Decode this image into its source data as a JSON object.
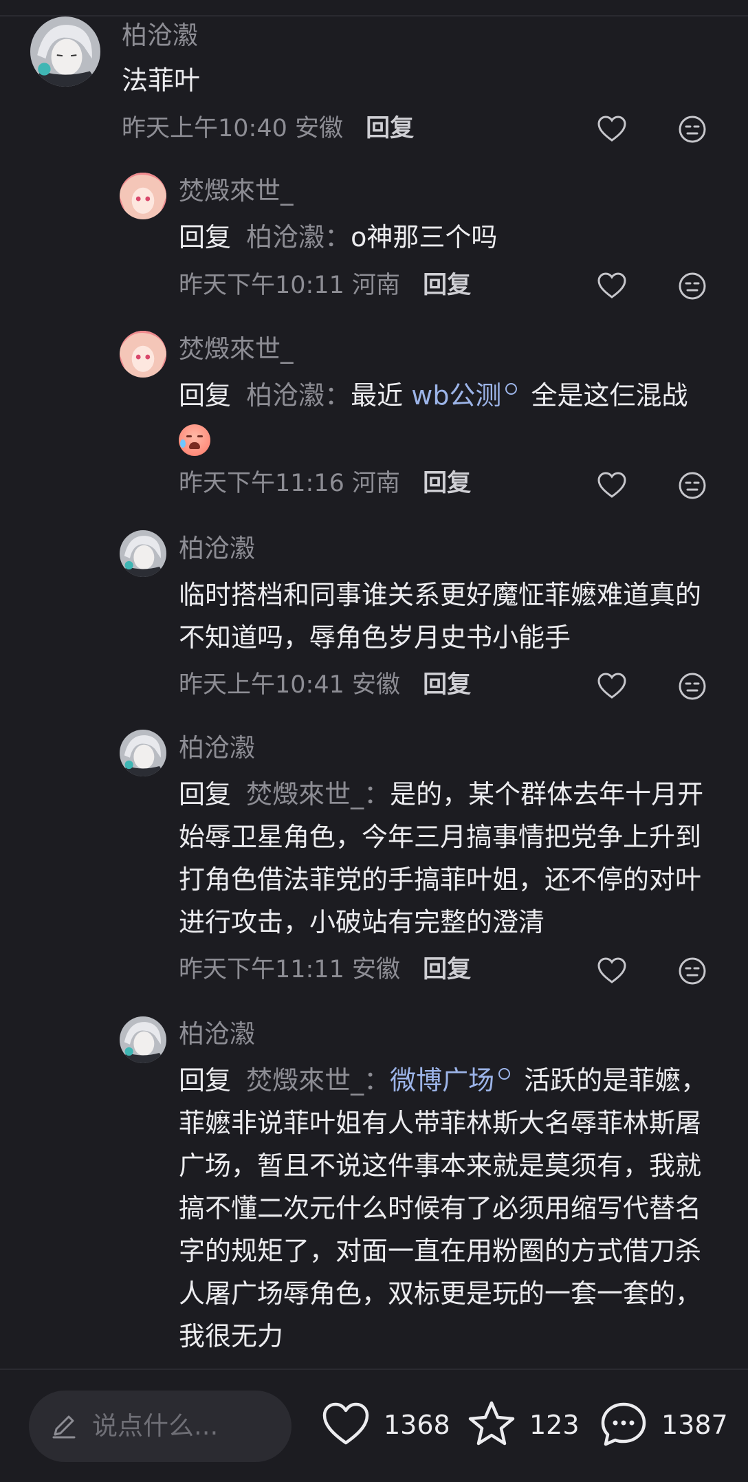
{
  "colors": {
    "background": "#1c1c21",
    "username": "#8d8d94",
    "text": "#ececef",
    "link": "#9cb4e8",
    "input_bg": "#2b2b31"
  },
  "comments": [
    {
      "username": "柏沧瀫",
      "body": "法菲叶",
      "time": "昨天上午10:40",
      "location": "安徽",
      "reply_label": "回复"
    },
    {
      "username": "焚燬來世_",
      "reply_prefix": "回复",
      "mention": "柏沧瀫",
      "sep": "：",
      "body": "o神那三个吗",
      "time": "昨天下午10:11",
      "location": "河南",
      "reply_label": "回复"
    },
    {
      "username": "焚燬來世_",
      "reply_prefix": "回复",
      "mention": "柏沧瀫",
      "sep": "：",
      "body_before": "最近 ",
      "link": "wb公测",
      "body_after": " 全是这仨混战",
      "emoji": "crying-laughing-emoji",
      "time": "昨天下午11:16",
      "location": "河南",
      "reply_label": "回复"
    },
    {
      "username": "柏沧瀫",
      "body": "临时搭档和同事谁关系更好魔怔菲嬷难道真的不知道吗，辱角色岁月史书小能手",
      "time": "昨天上午10:41",
      "location": "安徽",
      "reply_label": "回复"
    },
    {
      "username": "柏沧瀫",
      "reply_prefix": "回复",
      "mention": "焚燬來世_",
      "sep": "：",
      "body": "是的，某个群体去年十月开始辱卫星角色，今年三月搞事情把党争上升到打角色借法菲党的手搞菲叶姐，还不停的对叶进行攻击，小破站有完整的澄清",
      "time": "昨天下午11:11",
      "location": "安徽",
      "reply_label": "回复"
    },
    {
      "username": "柏沧瀫",
      "reply_prefix": "回复",
      "mention": "焚燬來世_",
      "sep": "：",
      "link": "微博广场",
      "body_after": " 活跃的是菲嬷，菲嬷非说菲叶姐有人带菲林斯大名辱菲林斯屠广场，暂且不说这件事本来就是莫须有，我就搞不懂二次元什么时候有了必须用缩写代替名字的规矩了，对面一直在用粉圈的方式借刀杀人屠广场辱角色，双标更是玩的一套一套的，我很无力"
    }
  ],
  "bottom_bar": {
    "input_placeholder": "说点什么...",
    "likes": "1368",
    "favorites": "123",
    "comments": "1387"
  }
}
